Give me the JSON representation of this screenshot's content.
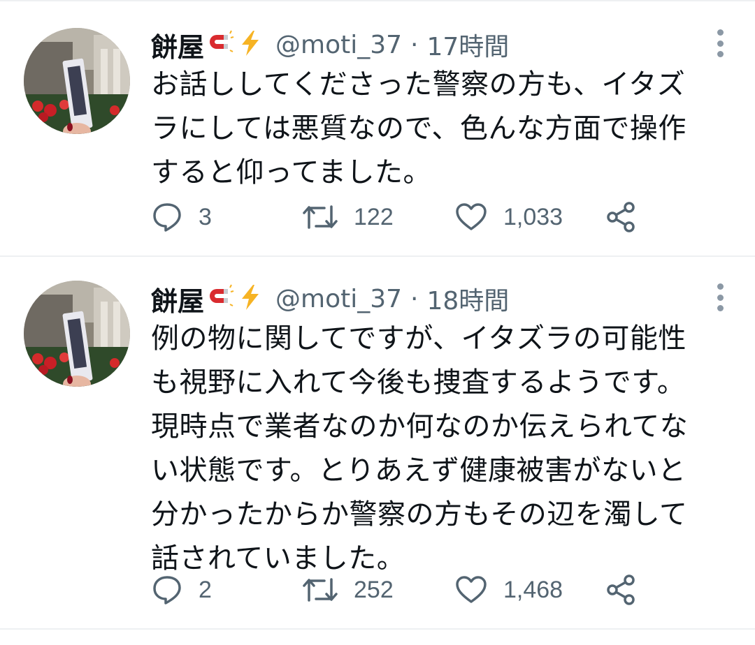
{
  "tweets": [
    {
      "display_name": "餅屋",
      "handle": "@moti_37",
      "separator": "·",
      "time": "17時間",
      "text": "お話ししてくださった警察の方も、イタズ\nラにしては悪質なので、色んな方面で操作\nすると仰ってました。",
      "replies": "3",
      "retweets": "122",
      "likes": "1,033"
    },
    {
      "display_name": "餅屋",
      "handle": "@moti_37",
      "separator": "·",
      "time": "18時間",
      "text": "例の物に関してですが、イタズラの可能性\nも視野に入れて今後も捜査するようです。\n現時点で業者なのか何なのか伝えられてな\nい状態です。とりあえず健康被害がないと\n分かったからか警察の方もその辺を濁して\n話されていました。",
      "replies": "2",
      "retweets": "252",
      "likes": "1,468"
    }
  ],
  "icons": {
    "name_emojis": [
      "magnet-icon",
      "lightning-icon"
    ],
    "actions": [
      "reply-icon",
      "retweet-icon",
      "like-icon",
      "share-icon"
    ]
  },
  "colors": {
    "text": "#0f1419",
    "secondary": "#536471",
    "divider": "#eef0f2",
    "magnet_red": "#d92b2f",
    "bolt_yellow": "#f6b324"
  }
}
